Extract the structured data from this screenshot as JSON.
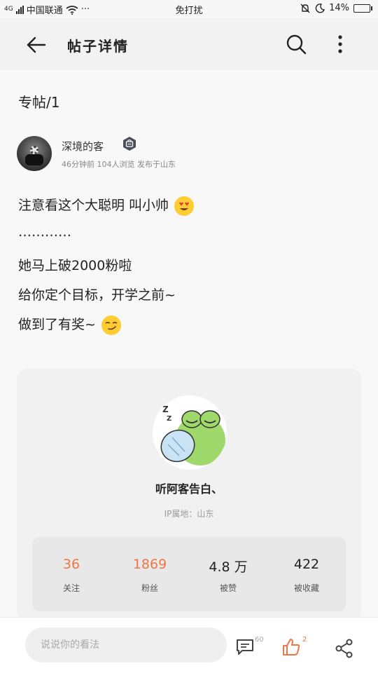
{
  "status_bar": {
    "signal_tag": "4G",
    "carrier": "中国联通",
    "dots": "···",
    "mode": "免打扰",
    "battery": "14%",
    "battery_level": 0.14
  },
  "header": {
    "title": "帖子详情",
    "icons": [
      "back-arrow-icon",
      "search-icon",
      "more-vertical-icon"
    ]
  },
  "post": {
    "floor": "专帖/1",
    "author": {
      "name": "深境的客",
      "meta": "46分钟前 104人浏览   发布于山东",
      "badge_icon": "bag-badge-icon"
    },
    "lines": [
      {
        "text": "注意看这个大聪明 叫小帅",
        "emoji": "heart-eyes-emoji"
      },
      {
        "text": "…………"
      },
      {
        "text": "她马上破2000粉啦"
      },
      {
        "text": "给你定个目标，开学之前~"
      },
      {
        "text": "做到了有奖~",
        "emoji": "smirk-emoji"
      }
    ]
  },
  "profile_card": {
    "name": "听阿客告白、",
    "ip": "IP属地：山东",
    "stats": [
      {
        "value": "36",
        "label": "关注",
        "color": "#f07545"
      },
      {
        "value": "1869",
        "label": "粉丝",
        "color": "#f07545"
      },
      {
        "value": "4.8 万",
        "label": "被赞",
        "color": "#222222"
      },
      {
        "value": "422",
        "label": "被收藏",
        "color": "#222222"
      }
    ]
  },
  "bottom_bar": {
    "input_placeholder": "说说你的看法",
    "comment_count": "60",
    "like_count": "2",
    "accent": "#f07545"
  }
}
